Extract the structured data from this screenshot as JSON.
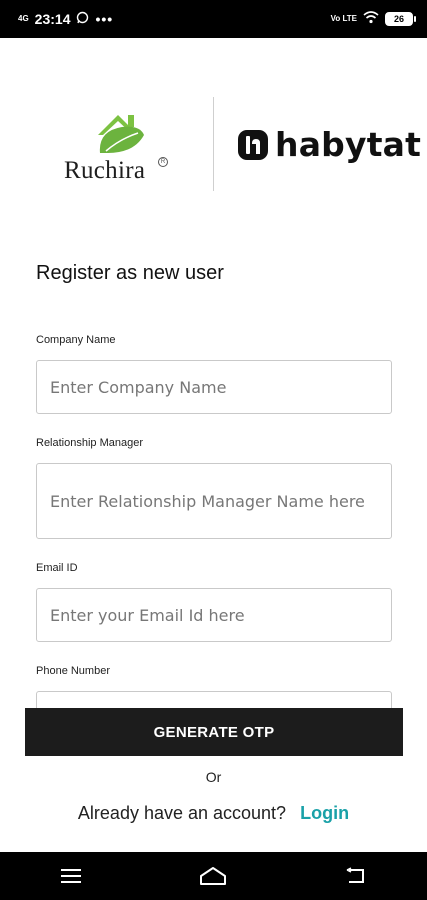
{
  "status_bar": {
    "time": "23:14",
    "signal_label": "4G",
    "volte_label": "Vo LTE",
    "battery": "26"
  },
  "logos": {
    "left_brand": "Ruchira",
    "right_brand": "habytat"
  },
  "page_title": "Register as new user",
  "form": {
    "company_name": {
      "label": "Company Name",
      "placeholder": "Enter Company Name"
    },
    "relationship_manager": {
      "label": "Relationship Manager",
      "placeholder": "Enter Relationship Manager Name here"
    },
    "email": {
      "label": "Email ID",
      "placeholder": "Enter your Email Id here"
    },
    "phone": {
      "label": "Phone Number",
      "placeholder": ""
    }
  },
  "actions": {
    "generate_otp": "GENERATE OTP",
    "or": "Or",
    "account_prompt": "Already have an account?",
    "login": "Login"
  },
  "icons": {
    "status": [
      "whatsapp-icon",
      "more-dots-icon",
      "wifi-icon",
      "battery-icon"
    ],
    "nav": [
      "menu-icon",
      "home-icon",
      "back-icon"
    ]
  },
  "colors": {
    "accent": "#1aa1a8",
    "button": "#1c1c1c",
    "leaf_green": "#7cc242"
  }
}
